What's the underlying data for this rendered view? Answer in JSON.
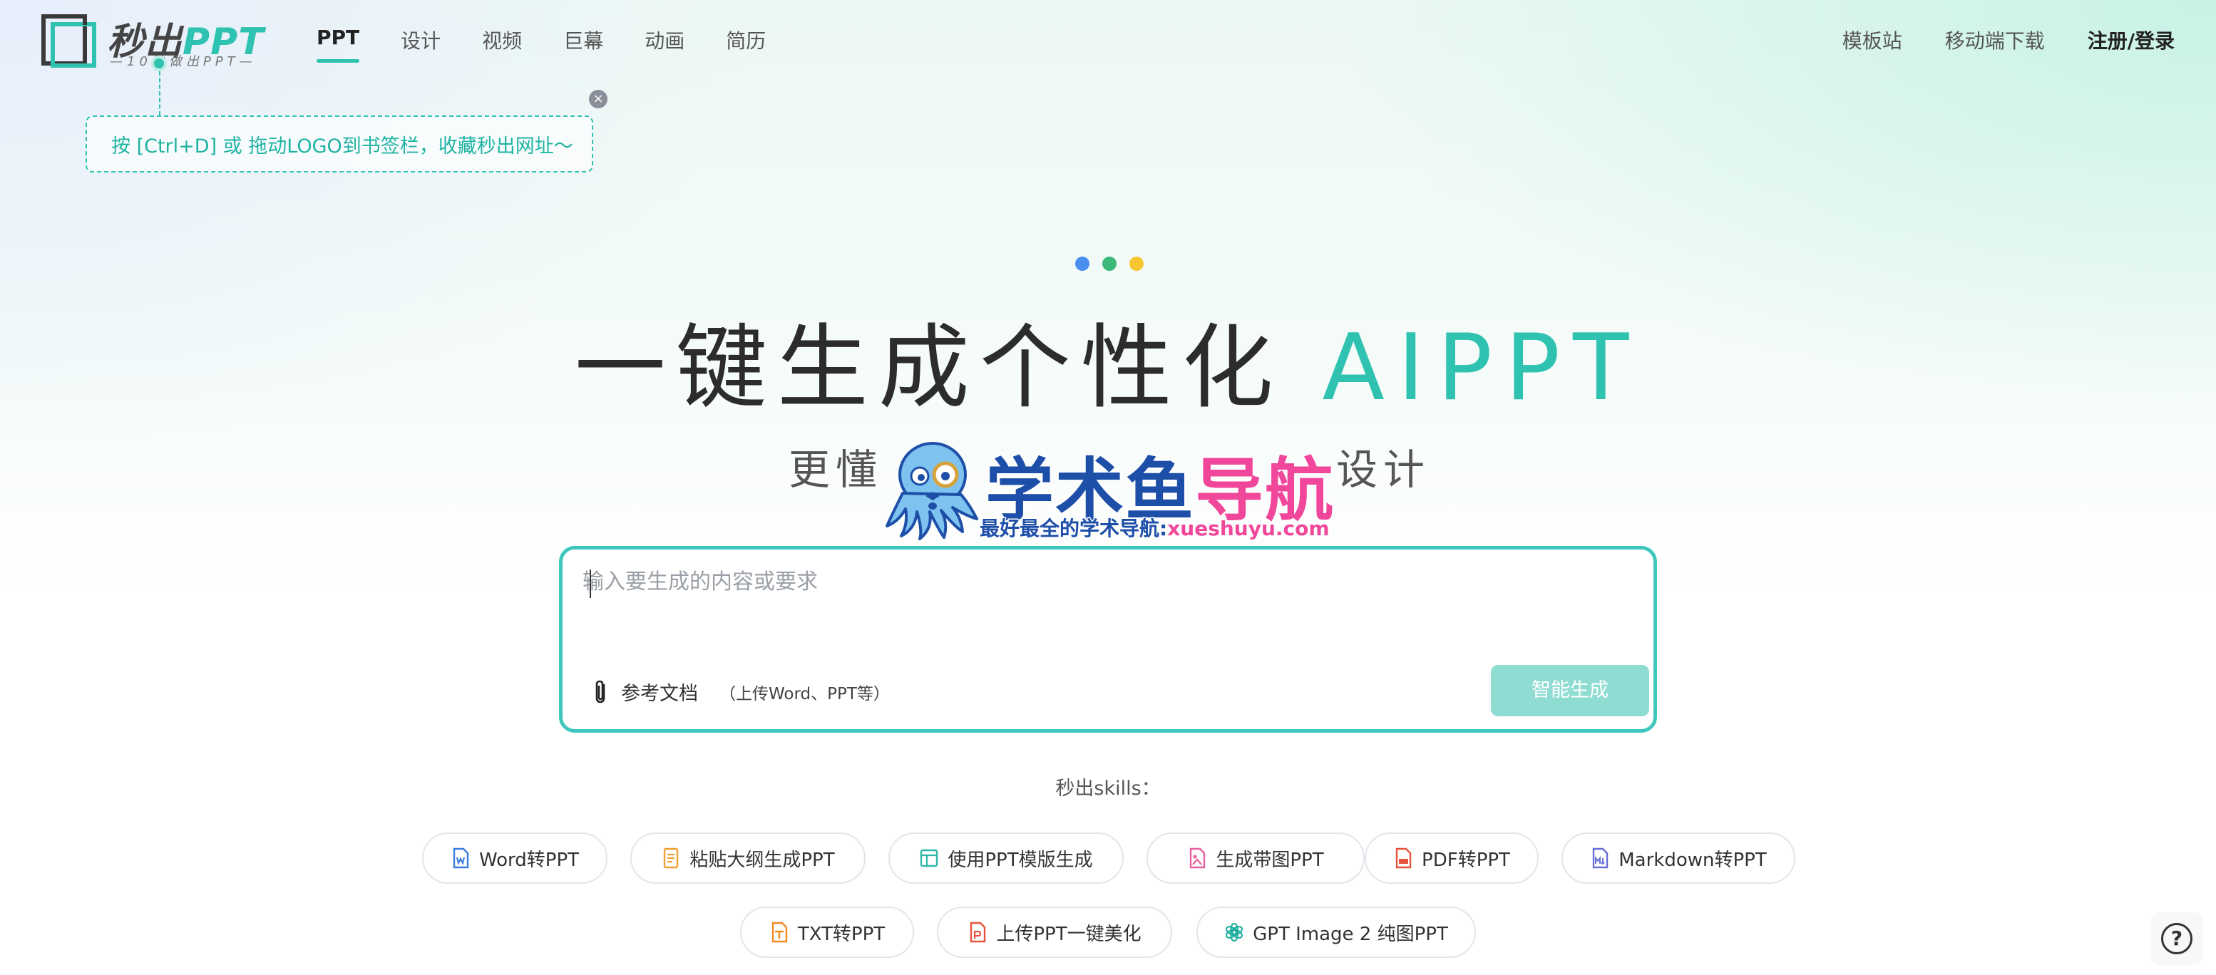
{
  "header": {
    "logo": {
      "title_cn": "秒出",
      "title_en": "PPT",
      "subtitle": "—10秒做出PPT—"
    },
    "nav": [
      {
        "label": "PPT",
        "active": true
      },
      {
        "label": "设计",
        "active": false
      },
      {
        "label": "视频",
        "active": false
      },
      {
        "label": "巨幕",
        "active": false
      },
      {
        "label": "动画",
        "active": false
      },
      {
        "label": "简历",
        "active": false
      }
    ],
    "right_nav": {
      "templates": "模板站",
      "mobile_download": "移动端下载",
      "login": "注册/登录"
    }
  },
  "bookmark_tip": {
    "text": "按 [Ctrl+D] 或 拖动LOGO到书签栏，收藏秒出网址～",
    "close_icon": "close-icon"
  },
  "hero": {
    "dots_colors": [
      "#4a8ef2",
      "#3cb878",
      "#f7c531"
    ],
    "title_main": "一键生成个性化",
    "title_accent": "AIPPT",
    "subtitle_left": "更懂",
    "subtitle_right": "设计"
  },
  "watermark": {
    "title_part1": "学术鱼",
    "title_part2": "导航",
    "caption_part1": "最好最全的学术导航:",
    "caption_part2": "xueshuyu.com"
  },
  "prompt": {
    "placeholder": "输入要生成的内容或要求",
    "value": "",
    "ref_doc_label": "参考文档",
    "ref_doc_hint": "（上传Word、PPT等）",
    "generate_button": "智能生成"
  },
  "skills": {
    "title": "秒出skills：",
    "items": [
      {
        "label": "Word转PPT",
        "icon": "word-doc-icon",
        "color": "#3c7be0"
      },
      {
        "label": "粘贴大纲生成PPT",
        "icon": "outline-doc-icon",
        "color": "#f0a030"
      },
      {
        "label": "使用PPT模版生成",
        "icon": "template-icon",
        "color": "#2fb7a8"
      },
      {
        "label": "生成带图PPT",
        "icon": "image-doc-icon",
        "color": "#e8619e"
      },
      {
        "label": "PDF转PPT",
        "icon": "pdf-doc-icon",
        "color": "#e5533c"
      },
      {
        "label": "Markdown转PPT",
        "icon": "markdown-doc-icon",
        "color": "#6a6fd6"
      },
      {
        "label": "TXT转PPT",
        "icon": "txt-doc-icon",
        "color": "#f28a20"
      },
      {
        "label": "上传PPT一键美化",
        "icon": "ppt-doc-icon",
        "color": "#e5533c"
      },
      {
        "label": "GPT Image 2 纯图PPT",
        "icon": "openai-icon",
        "color": "#1fae9c"
      }
    ]
  },
  "help": {
    "label": "?"
  }
}
